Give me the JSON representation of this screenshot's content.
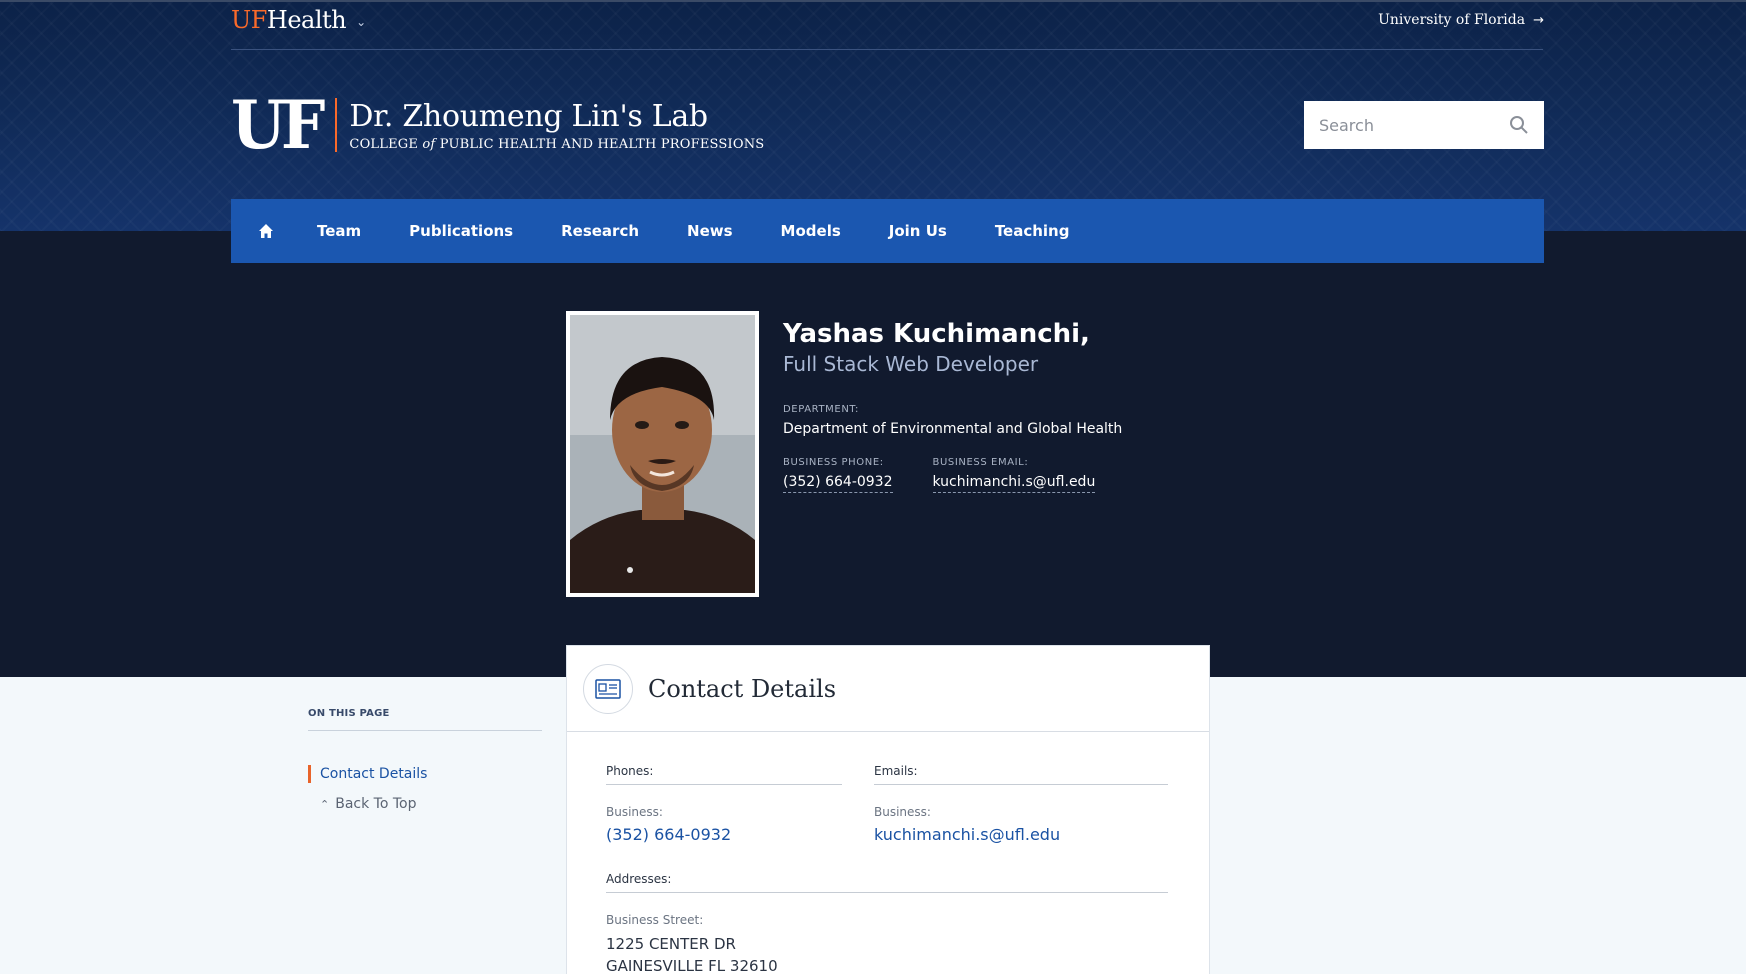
{
  "header": {
    "logo_uf": "UF",
    "logo_health": "Health",
    "university_link": "University of Florida",
    "uf_mark": "UF",
    "lab_title": "Dr. Zhoumeng Lin's Lab",
    "college_pre": "COLLEGE",
    "college_of": "of",
    "college_post": "PUBLIC HEALTH AND HEALTH PROFESSIONS",
    "search_placeholder": "Search"
  },
  "nav": {
    "items": [
      "Team",
      "Publications",
      "Research",
      "News",
      "Models",
      "Join Us",
      "Teaching"
    ]
  },
  "profile": {
    "name": "Yashas Kuchimanchi,",
    "title": "Full Stack Web Developer",
    "department_label": "DEPARTMENT:",
    "department": "Department of Environmental and Global Health",
    "phone_label": "BUSINESS PHONE:",
    "phone": "(352) 664-0932",
    "email_label": "BUSINESS EMAIL:",
    "email": "kuchimanchi.s@ufl.edu"
  },
  "sidebar": {
    "heading": "ON THIS PAGE",
    "active_item": "Contact Details",
    "back_to_top": "Back To Top"
  },
  "contact": {
    "title": "Contact Details",
    "phones_heading": "Phones:",
    "phones_sub": "Business:",
    "phone": "(352) 664-0932",
    "emails_heading": "Emails:",
    "emails_sub": "Business:",
    "email": "kuchimanchi.s@ufl.edu",
    "addresses_heading": "Addresses:",
    "address_sub": "Business Street:",
    "address_line1": "1225 CENTER DR",
    "address_line2": "GAINESVILLE FL 32610"
  },
  "colors": {
    "header_navy": "#0c2248",
    "nav_blue": "#1b57b0",
    "profile_band": "#111a2e",
    "accent_orange": "#fa6a2a",
    "link_blue": "#1a52a3"
  }
}
